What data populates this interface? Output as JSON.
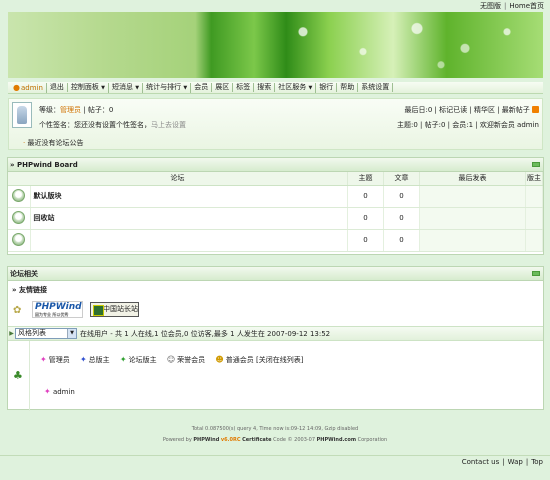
{
  "toplinks": {
    "wap": "无图版",
    "home": "Home首页"
  },
  "nav": {
    "user": "admin",
    "items": [
      "退出",
      "控制面板",
      "短消息",
      "统计与排行",
      "会员",
      "展区",
      "标签",
      "搜索",
      "社区服务",
      "银行",
      "帮助",
      "系统设置"
    ]
  },
  "userbox": {
    "level_label": "等级：",
    "level_value": "管理员",
    "posts": "帖子：0",
    "signature_label": "个性签名：您还没有设置个性签名，",
    "signature_link": "马上去设置",
    "announcement": "最近没有论坛公告",
    "stats_right1": [
      "最后日:0",
      "标记已读",
      "精华区",
      "最新帖子"
    ],
    "stats_right2": "主题:0 | 帖子:0 | 会员:1 | 欢迎新会员 admin"
  },
  "board": {
    "title": "» PHPwind Board",
    "headers": [
      "论坛",
      "主题",
      "文章",
      "最后发表",
      "版主"
    ],
    "rows": [
      {
        "name": "默认版块",
        "topics": "0",
        "posts": "0"
      },
      {
        "name": "回收站",
        "topics": "0",
        "posts": "0"
      },
      {
        "name": "",
        "topics": "0",
        "posts": "0"
      }
    ]
  },
  "related": {
    "title": "论坛相关",
    "friends_title": "» 友情链接",
    "logo1": "PHPWind",
    "logo1_sub": "因为专业 所以优秀",
    "logo2": "中国站长站",
    "style_select": "风格列表",
    "online_text": "在线用户 - 共 1 人在线,1 位会员,0 位访客,最多 1 人发生在 2007-09-12 13:52",
    "legend": [
      "管理员",
      "总版主",
      "论坛版主",
      "荣誉会员",
      "普通会员"
    ],
    "close_online": "[关闭在线列表]",
    "online_user": "admin"
  },
  "footer": {
    "line1": "Total 0.087500(s) query 4, Time now is:09-12 14:09, Gzip disabled",
    "powered": "Powered by",
    "brand": "PHPWind",
    "version": "v6.0RC",
    "cert": "Certificate",
    "code": "Code © 2003-07",
    "site": "PHPWind.com",
    "corp": "Corporation"
  },
  "bottom": {
    "contact": "Contact us",
    "wap": "Wap",
    "top": "Top"
  }
}
